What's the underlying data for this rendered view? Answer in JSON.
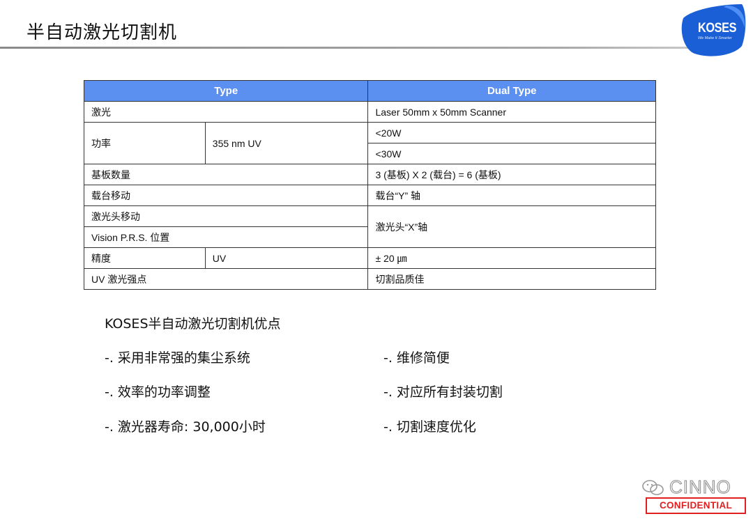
{
  "slide": {
    "title": "半自动激光切割机"
  },
  "logo": {
    "brand": "KOSES",
    "tagline": "We Make It Smarter",
    "color": "#1a5fd6"
  },
  "table": {
    "header_color": "#5b8ff0",
    "headers": [
      "Type",
      "Dual Type"
    ],
    "rows": {
      "laser": {
        "label": "激光",
        "value": "Laser 50mm x 50mm Scanner"
      },
      "power": {
        "label": "功率",
        "spec": "355 nm UV",
        "value1": "<20W",
        "value2": "<30W"
      },
      "substrate": {
        "label": "基板数量",
        "value": "3 (基板) X 2 (载台) = 6 (基板)"
      },
      "stage": {
        "label": "载台移动",
        "value": "载台“Y” 轴"
      },
      "head": {
        "label": "激光头移动",
        "value": "激光头“X”轴"
      },
      "vision": {
        "label": "Vision P.R.S. 位置"
      },
      "precision": {
        "label": "精度",
        "spec": "UV",
        "value": "± 20 ㎛"
      },
      "uv_strength": {
        "label": "UV 激光强点",
        "value": "切割品质佳"
      }
    }
  },
  "advantages": {
    "title": "KOSES半自动激光切割机优点",
    "left": [
      "-. 采用非常强的集尘系统",
      "-. 效率的功率调整",
      "-. 激光器寿命: 30,000小时"
    ],
    "right": [
      "-. 维修简便",
      "-. 对应所有封装切割",
      "-. 切割速度优化"
    ]
  },
  "footer": {
    "watermark": "CINNO",
    "badge": "CONFIDENTIAL",
    "badge_color": "#e02020"
  }
}
